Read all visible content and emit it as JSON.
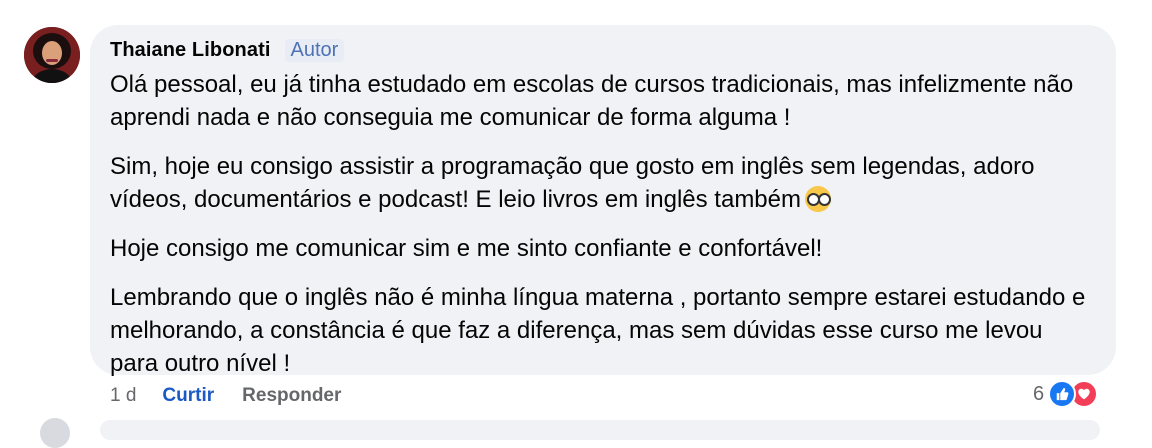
{
  "comment": {
    "author": "Thaiane Libonati",
    "badge": "Autor",
    "paragraphs": [
      "Olá pessoal, eu já tinha estudado em escolas de cursos tradicionais, mas infelizmente não aprendi nada e não conseguia me comunicar de forma alguma !",
      "Sim, hoje eu consigo assistir a programação que gosto em inglês sem legendas, adoro vídeos, documentários e podcast! E leio livros em inglês também",
      "Hoje consigo me comunicar sim e me sinto confiante e confortável!",
      "Lembrando que o inglês não é minha língua materna , portanto sempre estarei estudando e melhorando, a constância é que faz a diferença, mas sem dúvidas esse curso me levou para outro nível !"
    ],
    "emoji": "nerd-glasses-emoji"
  },
  "actions": {
    "time": "1 d",
    "like_label": "Curtir",
    "reply_label": "Responder"
  },
  "reactions": {
    "count": "6",
    "icons": [
      "thumbs-up-icon",
      "heart-icon"
    ],
    "colors": {
      "like": "#1877f2",
      "love": "#f33e58"
    }
  },
  "colors": {
    "bubble_bg": "#f0f2f5",
    "link_blue": "#1b59c4",
    "muted": "#65676b"
  }
}
